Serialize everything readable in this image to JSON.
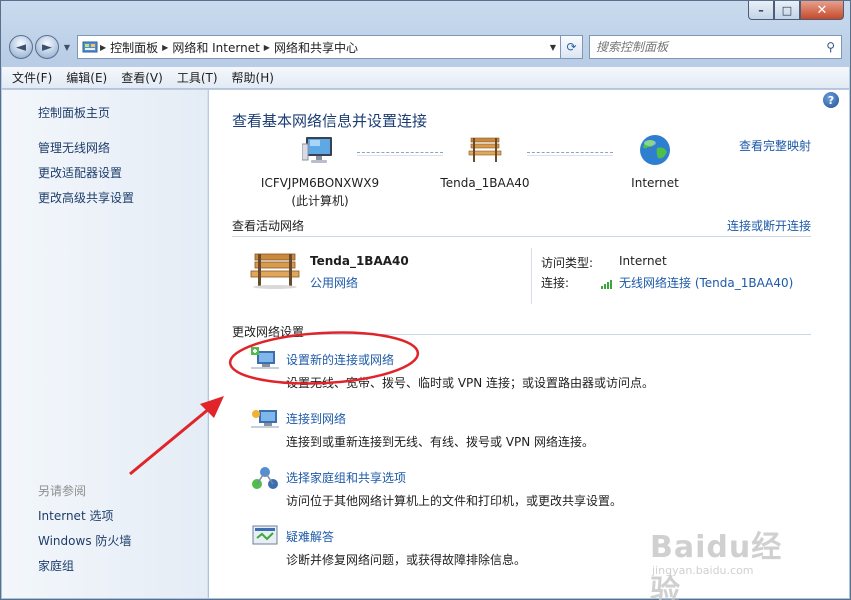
{
  "window": {
    "caption_buttons": {
      "minimize": "–",
      "maximize": "□",
      "close": "✕"
    }
  },
  "nav": {
    "back_icon": "◄",
    "forward_icon": "►",
    "breadcrumb": [
      "控制面板",
      "网络和 Internet",
      "网络和共享中心"
    ],
    "refresh_icon": "⟳",
    "search_placeholder": "搜索控制面板",
    "search_icon": "⚲"
  },
  "menu": [
    "文件(F)",
    "编辑(E)",
    "查看(V)",
    "工具(T)",
    "帮助(H)"
  ],
  "sidebar": {
    "home": "控制面板主页",
    "links": [
      "管理无线网络",
      "更改适配器设置",
      "更改高级共享设置"
    ],
    "see_also_title": "另请参阅",
    "see_also": [
      "Internet 选项",
      "Windows 防火墙",
      "家庭组"
    ]
  },
  "main": {
    "help": "?",
    "title": "查看基本网络信息并设置连接",
    "map_link": "查看完整映射",
    "nodes": {
      "computer": {
        "name": "ICFVJPM6BONXWX9",
        "sub": "(此计算机)"
      },
      "router": {
        "name": "Tenda_1BAA40"
      },
      "internet": {
        "name": "Internet"
      }
    },
    "active": {
      "heading": "查看活动网络",
      "link": "连接或断开连接",
      "network_name": "Tenda_1BAA40",
      "network_type": "公用网络",
      "access_label": "访问类型:",
      "access_value": "Internet",
      "conn_label": "连接:",
      "conn_value": "无线网络连接 (Tenda_1BAA40)"
    },
    "change": {
      "heading": "更改网络设置",
      "tasks": [
        {
          "title": "设置新的连接或网络",
          "desc": "设置无线、宽带、拨号、临时或 VPN 连接；或设置路由器或访问点。"
        },
        {
          "title": "连接到网络",
          "desc": "连接到或重新连接到无线、有线、拨号或 VPN 网络连接。"
        },
        {
          "title": "选择家庭组和共享选项",
          "desc": "访问位于其他网络计算机上的文件和打印机，或更改共享设置。"
        },
        {
          "title": "疑难解答",
          "desc": "诊断并修复网络问题，或获得故障排除信息。"
        }
      ]
    }
  },
  "watermark": {
    "brand": "Baidu经验",
    "url": "jingyan.baidu.com"
  },
  "colors": {
    "link": "#1e5aa8",
    "title": "#1b3d74",
    "annotation": "#e0242a"
  }
}
